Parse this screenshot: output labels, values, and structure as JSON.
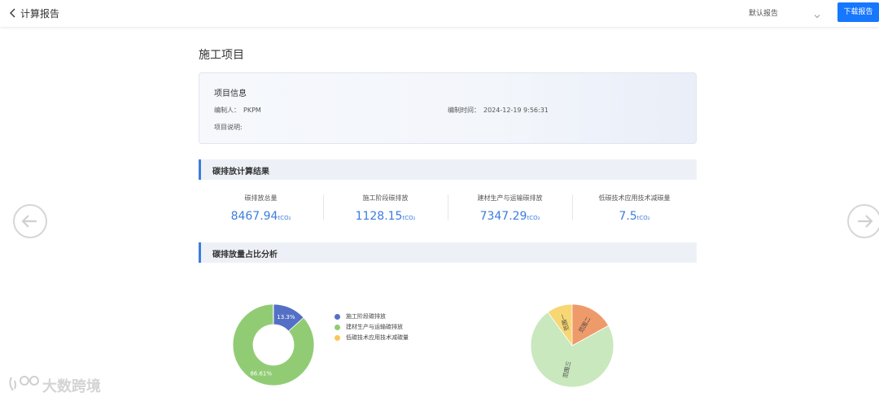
{
  "header": {
    "back_label": "计算报告",
    "report_select_value": "默认报告",
    "download_label": "下载报告"
  },
  "project": {
    "title": "施工项目",
    "info_heading": "项目信息",
    "author_label": "编制人：",
    "author_value": "PKPM",
    "time_label": "编制时间：",
    "time_value": "2024-12-19 9:56:31",
    "desc_label": "项目说明:"
  },
  "results": {
    "section_title": "碳排放计算结果",
    "unit": "tCO₂",
    "stats": [
      {
        "label": "碳排放总量",
        "value": "8467.94"
      },
      {
        "label": "施工阶段碳排放",
        "value": "1128.15"
      },
      {
        "label": "建材生产与运输碳排放",
        "value": "7347.29"
      },
      {
        "label": "低碳技术应用技术减碳量",
        "value": "7.5"
      }
    ]
  },
  "analysis": {
    "section_title": "碳排放量占比分析"
  },
  "chart_data": [
    {
      "type": "pie",
      "variant": "donut",
      "legend_position": "right",
      "categories": [
        "施工阶段碳排放",
        "建材生产与运输碳排放",
        "低碳技术应用技术减碳量"
      ],
      "values": [
        13.3,
        86.61,
        0.09
      ],
      "data_labels": [
        "13.3%",
        "86.61%",
        ""
      ],
      "colors": [
        "#5470c6",
        "#91cc75",
        "#fac858"
      ]
    },
    {
      "type": "pie",
      "categories": [
        "范围一",
        "范围二",
        "范围三"
      ],
      "values": [
        10,
        17,
        73
      ],
      "data_labels": [
        "范围一",
        "范围二",
        "范围三"
      ],
      "colors": [
        "#f7d774",
        "#ee9a6a",
        "#c9e8bd"
      ]
    }
  ],
  "watermark": {
    "text": "大数跨境"
  },
  "icons": {
    "back": "chevron-left-icon",
    "select": "chevron-down-icon",
    "prev": "arrow-left-circle-icon",
    "next": "arrow-right-circle-icon",
    "watermark": "logo-icon"
  }
}
